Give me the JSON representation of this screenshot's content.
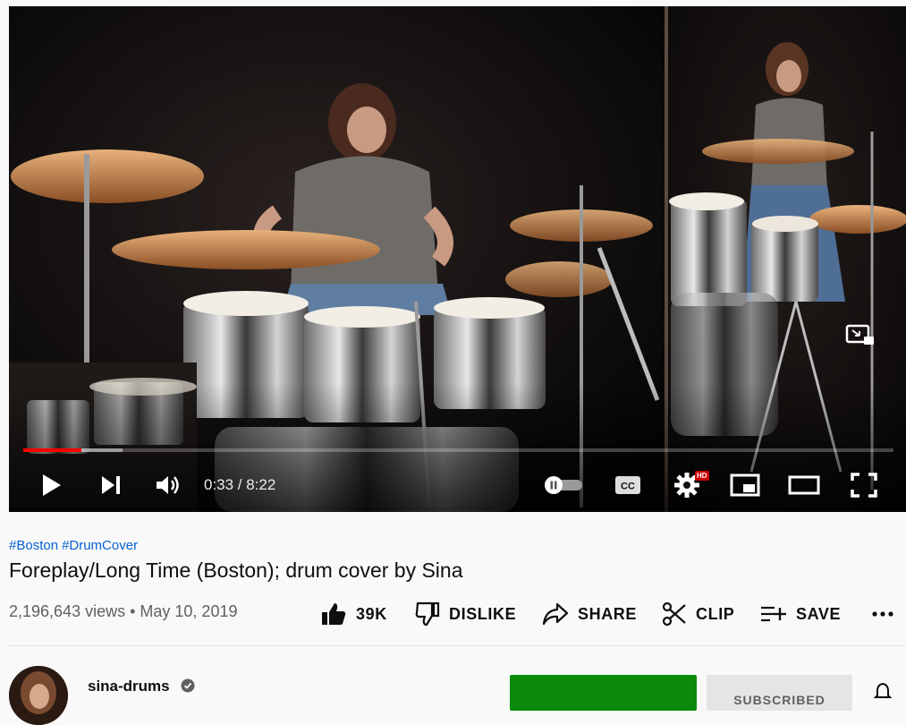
{
  "player": {
    "time_display": "0:33 / 8:22",
    "progress_played_fraction": 0.067,
    "progress_loaded_fraction": 0.114,
    "hd_badge": "HD",
    "buttons": {
      "play": "play-icon",
      "next": "next-icon",
      "volume": "volume-icon",
      "autoplay": "autoplay-toggle-icon",
      "captions": "cc-icon",
      "settings": "gear-icon",
      "miniplayer": "miniplayer-icon",
      "theater": "theater-icon",
      "fullscreen": "fullscreen-icon"
    },
    "accent_color": "#ff0000"
  },
  "video": {
    "hashtags": [
      "#Boston",
      "#DrumCover"
    ],
    "title": "Foreplay/Long Time (Boston); drum cover by Sina",
    "views": "2,196,643 views",
    "date": "May 10, 2019",
    "separator": "•"
  },
  "actions": {
    "like": "39K",
    "dislike": "DISLIKE",
    "share": "SHARE",
    "clip": "CLIP",
    "save": "SAVE",
    "more": "more-icon"
  },
  "channel": {
    "name": "sina-drums",
    "verified_icon": "verified-check-icon",
    "subscribe_label": "SUBSCRIBED",
    "join_color": "#0c8a0c",
    "bell_icon": "bell-icon"
  }
}
